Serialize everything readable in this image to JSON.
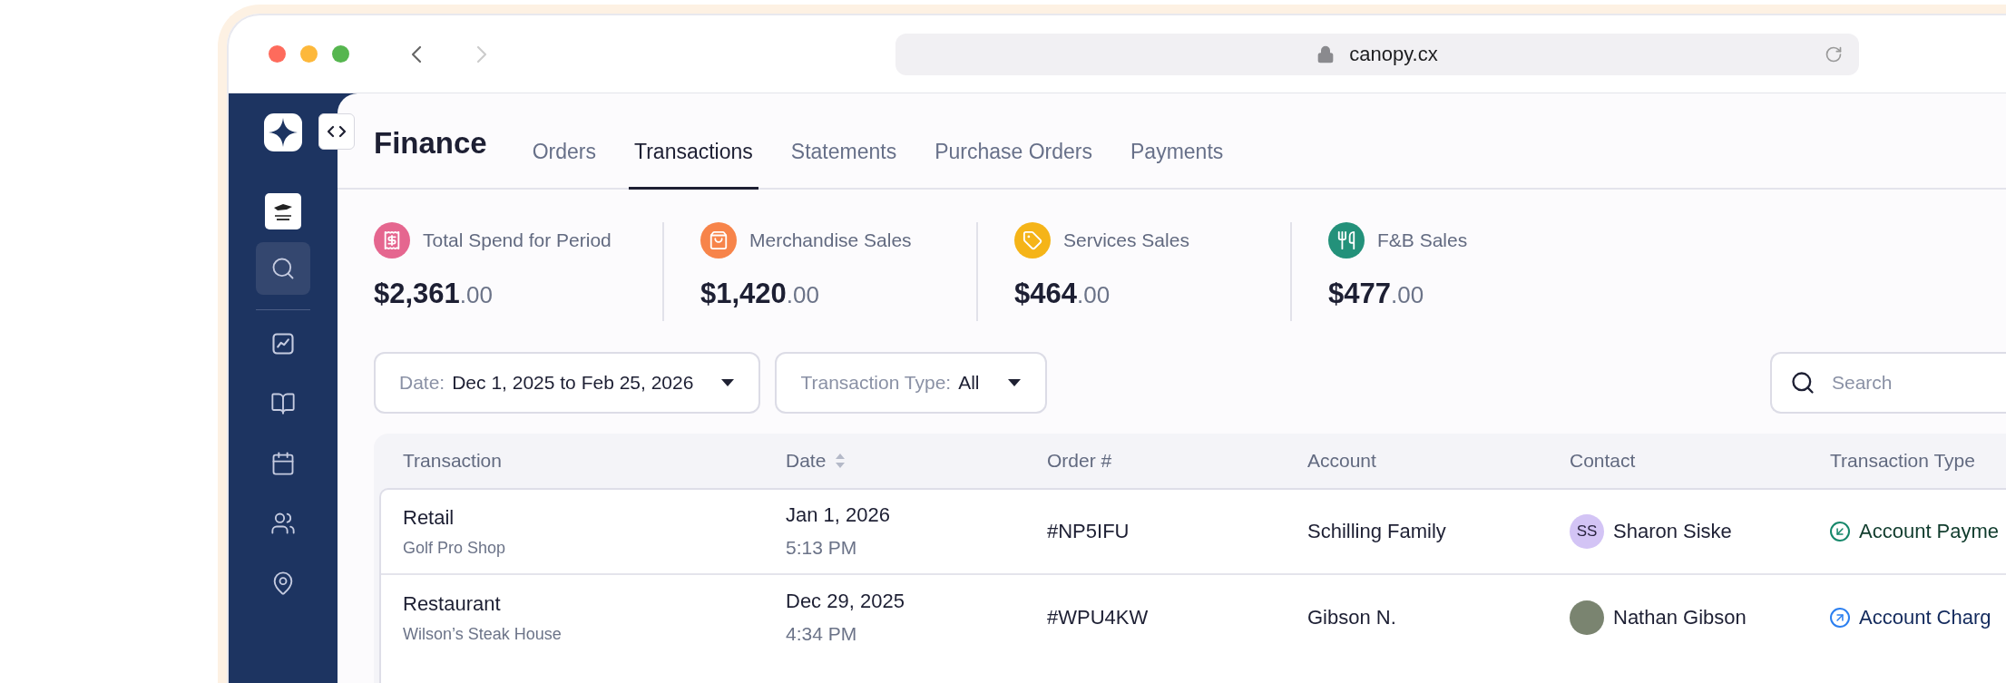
{
  "browser": {
    "url": "canopy.cx"
  },
  "sidebar": {
    "items": [
      {
        "selected": true
      },
      {
        "selected": false
      },
      {
        "selected": false
      },
      {
        "selected": false
      },
      {
        "selected": false
      },
      {
        "selected": false
      }
    ]
  },
  "header": {
    "title": "Finance"
  },
  "tabs": [
    {
      "label": "Orders",
      "selected": false
    },
    {
      "label": "Transactions",
      "selected": true
    },
    {
      "label": "Statements",
      "selected": false
    },
    {
      "label": "Purchase Orders",
      "selected": false
    },
    {
      "label": "Payments",
      "selected": false
    }
  ],
  "stats": [
    {
      "label": "Total Spend for Period",
      "whole": "$2,361",
      "cents": ".00",
      "color": "#e5668f"
    },
    {
      "label": "Merchandise Sales",
      "whole": "$1,420",
      "cents": ".00",
      "color": "#f7844a"
    },
    {
      "label": "Services Sales",
      "whole": "$464",
      "cents": ".00",
      "color": "#f5b418"
    },
    {
      "label": "F&B Sales",
      "whole": "$477",
      "cents": ".00",
      "color": "#23917a"
    }
  ],
  "filters": [
    {
      "label": "Date:",
      "value": "Dec 1, 2025 to Feb 25, 2026"
    },
    {
      "label": "Transaction Type:",
      "value": "All"
    }
  ],
  "search": {
    "placeholder": "Search"
  },
  "table": {
    "columns": [
      {
        "label": "Transaction",
        "sortable": false
      },
      {
        "label": "Date",
        "sortable": true
      },
      {
        "label": "Order #",
        "sortable": false
      },
      {
        "label": "Account",
        "sortable": false
      },
      {
        "label": "Contact",
        "sortable": false
      },
      {
        "label": "Transaction Type",
        "sortable": false
      }
    ],
    "rows": [
      {
        "transaction": "Retail",
        "location": "Golf Pro Shop",
        "date": "Jan 1, 2026",
        "time": "5:13 PM",
        "order": "#NP5IFU",
        "account": "Schilling Family",
        "contact": {
          "kind": "initials",
          "initials": "SS",
          "name": "Sharon Siske"
        },
        "type": {
          "kind": "payment",
          "text": "Account Payme"
        }
      },
      {
        "transaction": "Restaurant",
        "location": "Wilson’s Steak House",
        "date": "Dec 29, 2025",
        "time": "4:34 PM",
        "order": "#WPU4KW",
        "account": "Gibson N.",
        "contact": {
          "kind": "photo",
          "name": "Nathan Gibson"
        },
        "type": {
          "kind": "charge",
          "text": "Account Charg"
        }
      }
    ]
  }
}
